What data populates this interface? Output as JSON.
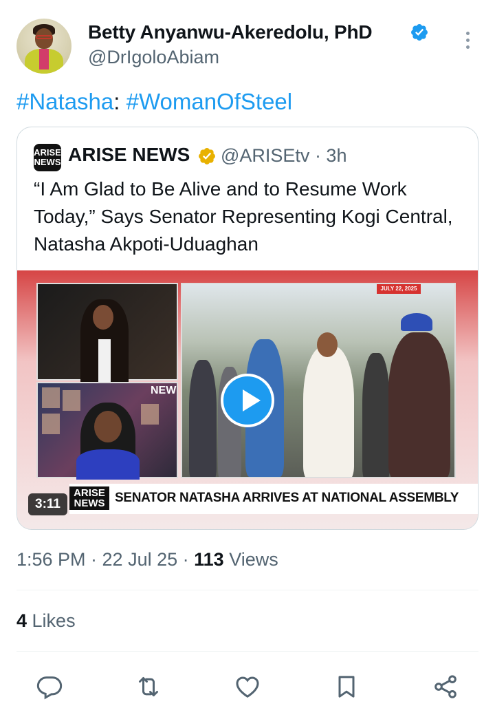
{
  "author": {
    "name": "Betty Anyanwu-Akeredolu, PhD",
    "handle": "@DrIgoloAbiam",
    "verified_color": "#1d9bf0"
  },
  "tweet": {
    "tag1": "#Natasha",
    "separator": ": ",
    "tag2": "#WomanOfSteel"
  },
  "quoted": {
    "logo_top": "ARISE",
    "logo_bottom": "NEWS",
    "name": "ARISE NEWS",
    "badge_color": "#e8b100",
    "handle_time": "@ARISEtv · 3h",
    "text": "“I Am Glad to Be Alive and to Resume Work Today,” Says Senator Representing Kogi Central, Natasha Akpoti-Uduaghan",
    "media": {
      "date_tag": "JULY 22, 2025",
      "channel_tag": "NEW",
      "bar_logo_top": "ARISE",
      "bar_logo_bottom": "NEWS",
      "headline": "SENATOR NATASHA ARRIVES AT NATIONAL ASSEMBLY",
      "duration": "3:11"
    }
  },
  "meta": {
    "time_date": "1:56 PM · 22 Jul 25 · ",
    "views_count": "113",
    "views_label": " Views"
  },
  "likes": {
    "count": "4",
    "label": " Likes"
  },
  "actions": [
    "reply-icon",
    "retweet-icon",
    "like-icon",
    "bookmark-icon",
    "share-icon"
  ]
}
